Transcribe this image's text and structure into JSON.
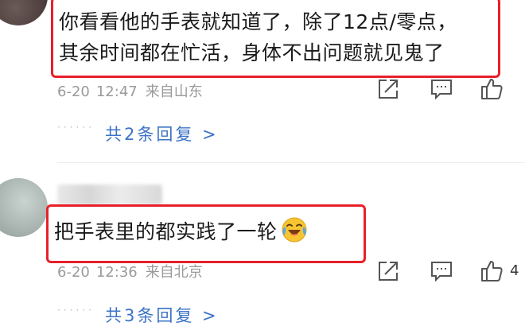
{
  "comments": [
    {
      "text_line1": "你看看他的手表就知道了，除了12点/零点，",
      "text_line2": "其余时间都在忙活，身体不出问题就见鬼了",
      "date": "6-20",
      "time": "12:47",
      "location": "来自山东",
      "like_count": "",
      "replies_label": "共2条回复 >"
    },
    {
      "text": "把手表里的都实践了一轮",
      "emoji": "laughing-crying-emoji",
      "date": "6-20",
      "time": "12:36",
      "location": "来自北京",
      "like_count": "4",
      "replies_label": "共3条回复 >"
    }
  ],
  "highlight_color": "#e8202a",
  "link_color": "#3c73c6"
}
